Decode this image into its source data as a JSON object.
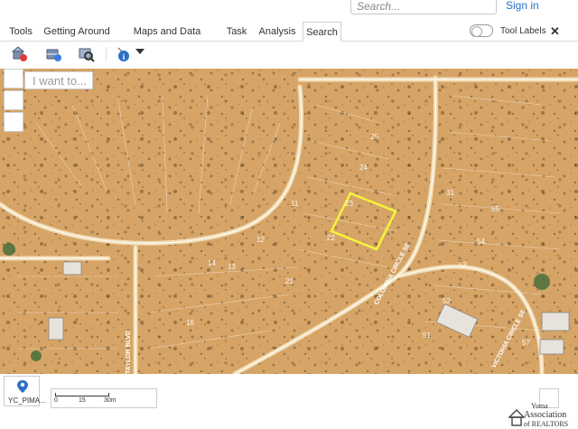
{
  "header": {
    "search_placeholder": "Search...",
    "signin_label": "Sign in"
  },
  "tabs": [
    {
      "label": "Tools"
    },
    {
      "label": "Getting Around"
    },
    {
      "label": "Maps and Data Sources"
    },
    {
      "label": "Task"
    },
    {
      "label": "Analysis"
    },
    {
      "label": "Search"
    }
  ],
  "tabbar": {
    "tool_labels": "Tool Labels",
    "close": "✕"
  },
  "toolbar": {
    "icons": [
      "search-address-icon",
      "search-parcel-icon",
      "search-zoom-icon",
      "identify-icon"
    ]
  },
  "map": {
    "iwant_placeholder": "I want to...",
    "street_labels": [
      "COLUMBIA CIRCLE SE",
      "TAYLOR BLVD",
      "VICTORIA CIRCLE SE"
    ],
    "lot_numbers": [
      "25",
      "24",
      "23",
      "22",
      "11",
      "12",
      "13",
      "14",
      "21",
      "16",
      "54",
      "53",
      "55",
      "31",
      "51",
      "52",
      "57"
    ],
    "highlight_color": "#f4f43a"
  },
  "bottom": {
    "basemap_label": "YC_PIMA...",
    "scale_labels": [
      "0",
      "15",
      "30m"
    ],
    "logo_line1": "Yuma",
    "logo_line2": "Association",
    "logo_line3": "of REALTORS"
  }
}
